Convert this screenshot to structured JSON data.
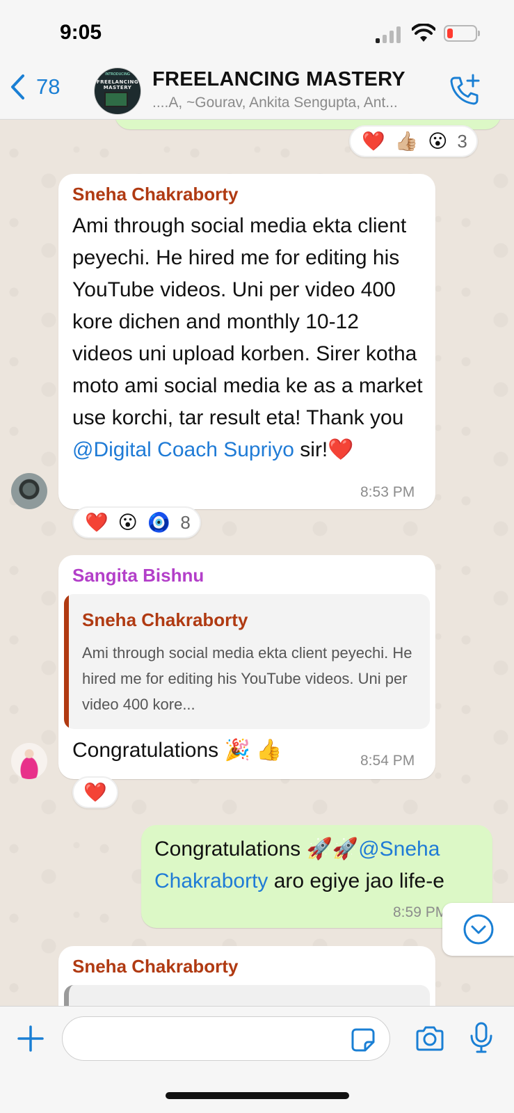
{
  "status_bar": {
    "time": "9:05"
  },
  "header": {
    "back_count": "78",
    "avatar_text_top": "INTRODUCING",
    "avatar_text_main": "FREELANCING MASTERY",
    "title": "FREELANCING MASTERY",
    "subtitle": "....A, ~Gourav, Ankita Sengupta, Ant..."
  },
  "top_reactions": {
    "emojis": [
      "❤️",
      "👍🏼",
      "😮"
    ],
    "count": "3"
  },
  "messages": [
    {
      "sender": "Sneha Chakraborty",
      "sender_color": "#b03a12",
      "text_before_mention": "Ami through social media ekta client peyechi. He hired me for editing his YouTube videos. Uni per video 400 kore dichen and monthly 10-12 videos uni upload korben. Sirer kotha moto ami social media ke as a market use korchi, tar result eta! Thank you ",
      "mention": "@Digital Coach Supriyo",
      "text_after_mention": " sir!❤️",
      "time": "8:53 PM",
      "reactions": {
        "emojis": [
          "❤️",
          "😮",
          "🧿"
        ],
        "count": "8"
      }
    },
    {
      "sender": "Sangita Bishnu",
      "sender_color": "#b33fc9",
      "quote_name": "Sneha Chakraborty",
      "quote_text": "Ami through social media ekta client peyechi. He hired me for editing his YouTube videos. Uni per video 400 kore...",
      "text": "Congratulations 🎉 👍",
      "time": "8:54 PM",
      "reactions": {
        "emojis": [
          "❤️"
        ]
      }
    },
    {
      "text_before_mention": "Congratulations 🚀🚀",
      "mention": "@Sneha Chakraborty",
      "text_after_mention": "  aro egiye jao life-e",
      "time": "8:59 PM"
    },
    {
      "sender": "Sneha Chakraborty",
      "sender_color": "#b03a12"
    }
  ],
  "input": {
    "placeholder": ""
  },
  "colors": {
    "accent": "#1a7fd4",
    "outgoing_bubble": "#dcf8c6",
    "incoming_bubble": "#ffffff",
    "mention": "#1f7bd6"
  }
}
